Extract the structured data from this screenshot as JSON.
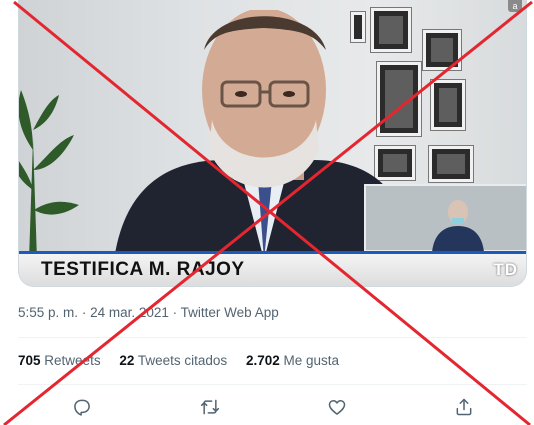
{
  "media": {
    "caption": "TESTIFICA M. RAJOY",
    "channel_logo": "TD",
    "corner_badge": "a"
  },
  "meta": {
    "time": "5:55 p. m.",
    "separator": "·",
    "date": "24 mar. 2021",
    "source": "Twitter Web App"
  },
  "stats": [
    {
      "count": "705",
      "label": "Retweets"
    },
    {
      "count": "22",
      "label": "Tweets citados"
    },
    {
      "count": "2.702",
      "label": "Me gusta"
    }
  ],
  "actions": [
    {
      "icon": "reply-icon"
    },
    {
      "icon": "retweet-icon"
    },
    {
      "icon": "like-icon"
    },
    {
      "icon": "share-icon"
    }
  ],
  "colors": {
    "overlay_x": "#e3262f",
    "banner_accent": "#1c5bbd",
    "muted_text": "#536471"
  }
}
